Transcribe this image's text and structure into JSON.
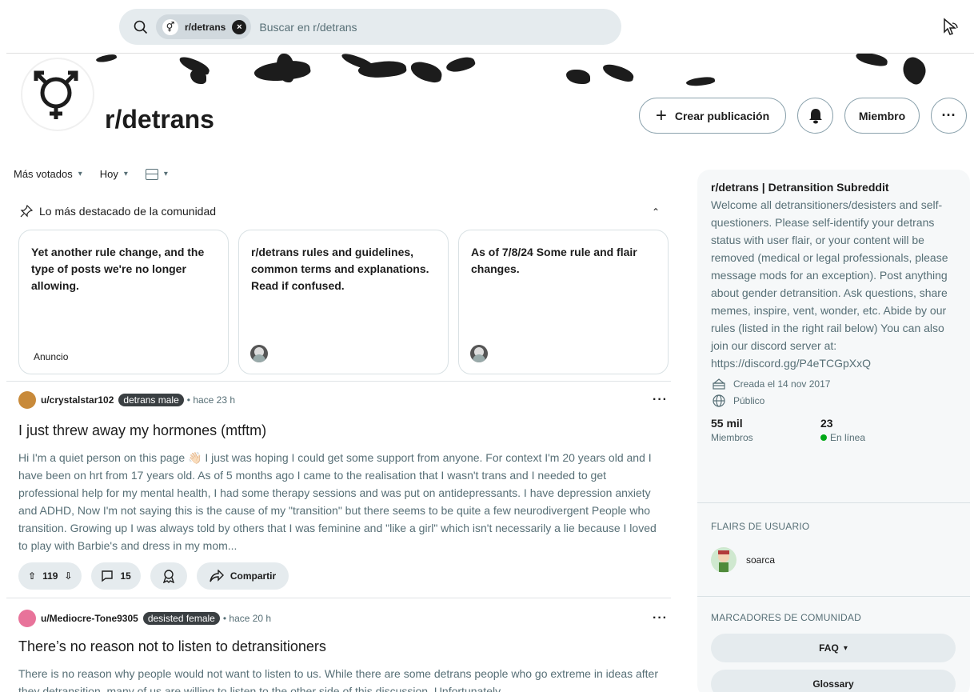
{
  "search": {
    "chip_label": "r/detrans",
    "placeholder": "Buscar en r/detrans"
  },
  "community": {
    "name": "r/detrans"
  },
  "header_actions": {
    "create_post": "Crear publicación",
    "member": "Miembro",
    "more": "···"
  },
  "sort": {
    "order": "Más votados",
    "time": "Hoy"
  },
  "highlights": {
    "heading": "Lo más destacado de la comunidad",
    "cards": [
      {
        "title": "Yet another rule change, and the type of posts we're no longer allowing.",
        "footer": "Anuncio"
      },
      {
        "title": "r/detrans rules and guidelines, common terms and explanations. Read if confused.",
        "footer": ""
      },
      {
        "title": "As of 7/8/24 Some rule and flair changes.",
        "footer": ""
      }
    ]
  },
  "posts": [
    {
      "user": "u/crystalstar102",
      "flair": "detrans male",
      "age": "• hace 23 h",
      "title": "I just threw away my hormones (mtftm)",
      "body": "Hi I'm a quiet person on this page 👋🏻 I just was hoping I could get some support from anyone. For context I'm 20 years old and I have been on hrt from 17 years old. As of 5 months ago I came to the realisation that I wasn't trans and I needed to get professional help for my mental health, I had some therapy sessions and was put on antidepressants. I have depression anxiety and ADHD, Now I'm not saying this is the cause of my \"transition\" but there seems to be quite a few neurodivergent People who transition. Growing up I was always told by others that I was feminine and \"like a girl\" which isn't necessarily a lie because I loved to play with Barbie's and dress in my mom...",
      "votes": "119",
      "comments": "15",
      "share": "Compartir"
    },
    {
      "user": "u/Mediocre-Tone9305",
      "flair": "desisted female",
      "age": "• hace 20 h",
      "title": "There’s no reason not to listen to detransitioners",
      "body": "There is no reason why people would not want to listen to us. While there are some detrans people who go extreme in ideas after they detransition, many of us are willing to listen to the other side of this discussion. Unfortunately"
    }
  ],
  "sidebar": {
    "title": "r/detrans | Detransition Subreddit",
    "description": "Welcome all detransitioners/desisters and self-questioners. Please self-identify your detrans status with user flair, or your content will be removed (medical or legal professionals, please message mods for an exception). Post anything about gender detransition. Ask questions, share memes, inspire, vent, wonder, etc. Abide by our rules (listed in the right rail below) You can also join our discord server at: https://discord.gg/P4eTCGpXxQ",
    "created": "Creada el 14 nov 2017",
    "visibility": "Público",
    "members_value": "55 mil",
    "members_label": "Miembros",
    "online_value": "23",
    "online_label": "En línea",
    "user_flairs_heading": "FLAIRS DE USUARIO",
    "user_flair_name": "soarca",
    "bookmarks_heading": "MARCADORES DE COMUNIDAD",
    "bookmarks": [
      "FAQ",
      "Glossary"
    ]
  },
  "colors": {
    "accent_online": "#01a816",
    "chip_bg": "#e5ebee",
    "flair_bg": "#3a3f42"
  }
}
